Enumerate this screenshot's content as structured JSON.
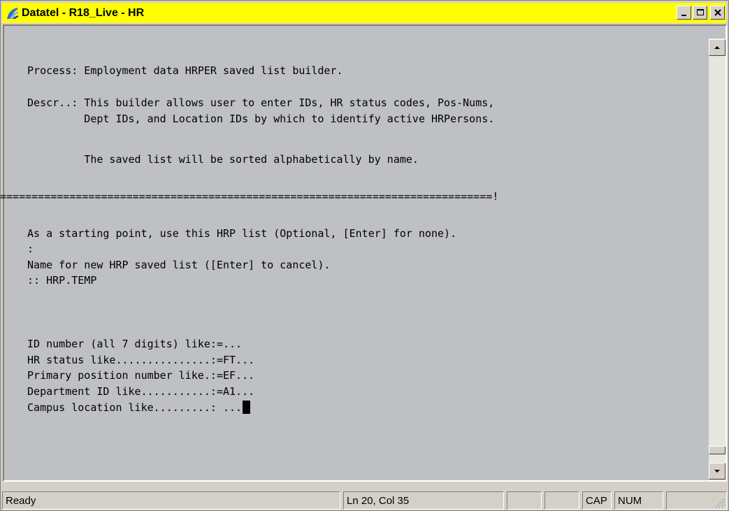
{
  "window": {
    "title": "Datatel - R18_Live - HR",
    "app_icon": "datatel-icon",
    "caption_buttons": [
      "minimize",
      "maximize",
      "close"
    ]
  },
  "terminal": {
    "lines": [
      " Process: Employment data HRPER saved list builder.",
      " Descr..: This builder allows user to enter IDs, HR status codes, Pos-Nums,",
      "          Dept IDs, and Location IDs by which to identify active HRPersons.",
      "          The saved list will be sorted alphabetically by name.",
      "==============================================================================!",
      " As a starting point, use this HRP list (Optional, [Enter] for none).",
      " :",
      " Name for new HRP saved list ([Enter] to cancel).",
      " :: HRP.TEMP",
      " ID number (all 7 digits) like:=...",
      " HR status like...............:=FT...",
      " Primary position number like.:=EF...",
      " Department ID like...........:=A1...",
      " Campus location like.........: ..."
    ]
  },
  "statusbar": {
    "status": "Ready",
    "position": "Ln 20, Col 35",
    "cap": "CAP",
    "num": "NUM"
  }
}
